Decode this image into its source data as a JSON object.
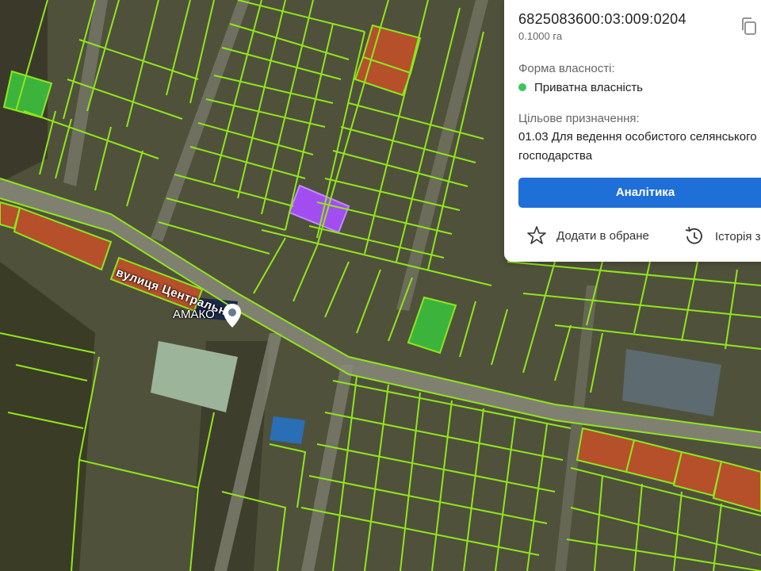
{
  "map": {
    "street_label": "вулиця Центральна",
    "poi_label": "АМАКО",
    "colors": {
      "parcel_outline": "#8fe61c",
      "highlight": "#a24df0",
      "ag_land": "#b5502b",
      "green_parcel": "#3cb43c"
    }
  },
  "panel": {
    "cadastral_number": "6825083600:03:009:0204",
    "area": "0.1000 га",
    "ownership_label": "Форма власності:",
    "ownership_value": "Приватна власність",
    "purpose_label": "Цільове призначення:",
    "purpose_line1": "01.03 Для ведення особистого селянського",
    "purpose_line2": "господарства",
    "analytics_button": "Аналітика",
    "favorite_label": "Додати в обране",
    "history_label": "Історія змін",
    "status_color": "#3cc85a",
    "button_color": "#1f6fd8"
  }
}
